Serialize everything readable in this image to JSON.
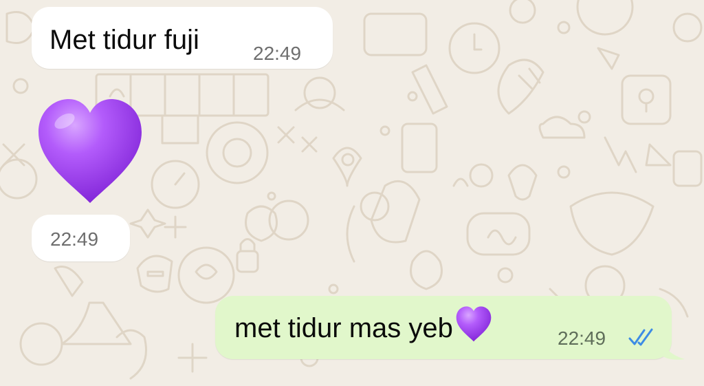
{
  "messages": [
    {
      "direction": "incoming",
      "text": "Met tidur fuji",
      "time": "22:49"
    },
    {
      "direction": "incoming",
      "type": "emoji",
      "emoji": "purple-heart",
      "time": "22:49"
    },
    {
      "direction": "outgoing",
      "text": "met tidur mas yeb",
      "emoji": "purple-heart",
      "time": "22:49",
      "status": "read"
    }
  ],
  "colors": {
    "background": "#f2ede5",
    "incoming_bubble": "#ffffff",
    "outgoing_bubble": "#e1f7cb",
    "read_ticks": "#3d8ce5",
    "heart": "#9b3ef0"
  },
  "icons": {
    "read_status": "double-check-icon",
    "wallpaper": "doodle-pattern"
  }
}
